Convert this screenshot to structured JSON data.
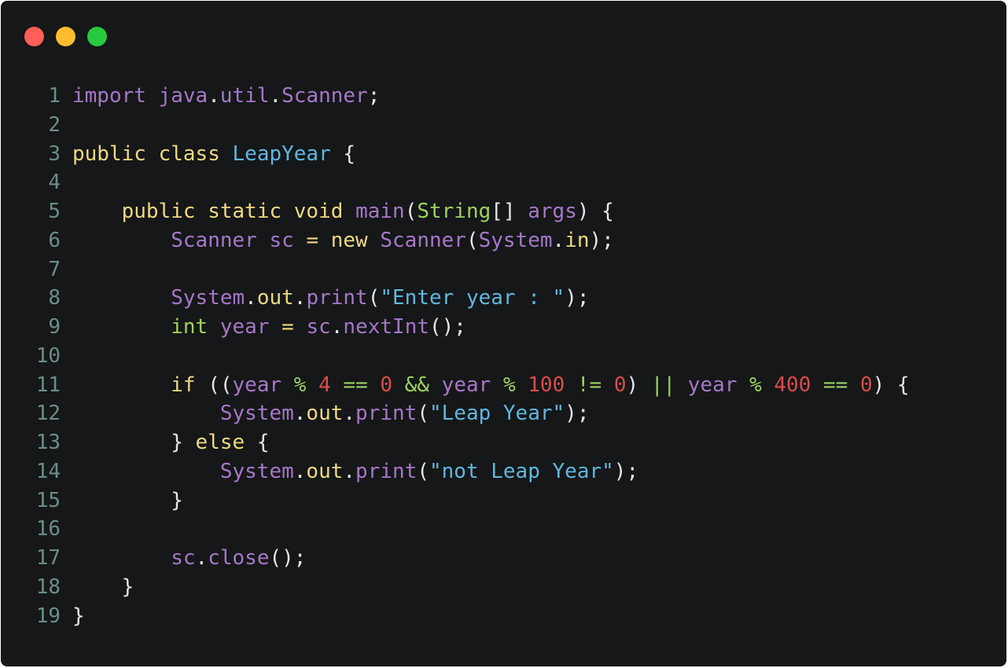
{
  "window": {
    "controls": [
      {
        "name": "close",
        "color": "#ff5f56"
      },
      {
        "name": "minimize",
        "color": "#ffbd2e"
      },
      {
        "name": "zoom",
        "color": "#27c93f"
      }
    ]
  },
  "colors": {
    "keyword": "#f0d880",
    "identifier": "#a677c8",
    "type": "#9ed25e",
    "class_name": "#5fb7e0",
    "string": "#5fb7e0",
    "number": "#dd4b4b",
    "operator": "#9ed25e",
    "punct": "#e6e6e6",
    "line_number": "#6b8d8a"
  },
  "code": {
    "language": "java",
    "lines": [
      {
        "n": "1",
        "tokens": [
          {
            "t": "import",
            "c": "identifier"
          },
          {
            "t": " ",
            "c": "punct"
          },
          {
            "t": "java",
            "c": "identifier"
          },
          {
            "t": ".",
            "c": "punct"
          },
          {
            "t": "util",
            "c": "identifier"
          },
          {
            "t": ".",
            "c": "punct"
          },
          {
            "t": "Scanner",
            "c": "identifier"
          },
          {
            "t": ";",
            "c": "punct"
          }
        ]
      },
      {
        "n": "2",
        "tokens": []
      },
      {
        "n": "3",
        "tokens": [
          {
            "t": "public",
            "c": "keyword"
          },
          {
            "t": " ",
            "c": "punct"
          },
          {
            "t": "class",
            "c": "keyword"
          },
          {
            "t": " ",
            "c": "punct"
          },
          {
            "t": "LeapYear",
            "c": "class_name"
          },
          {
            "t": " {",
            "c": "punct"
          }
        ]
      },
      {
        "n": "4",
        "tokens": []
      },
      {
        "n": "5",
        "tokens": [
          {
            "t": "    ",
            "c": "punct"
          },
          {
            "t": "public",
            "c": "keyword"
          },
          {
            "t": " ",
            "c": "punct"
          },
          {
            "t": "static",
            "c": "keyword"
          },
          {
            "t": " ",
            "c": "punct"
          },
          {
            "t": "void",
            "c": "keyword"
          },
          {
            "t": " ",
            "c": "punct"
          },
          {
            "t": "main",
            "c": "identifier"
          },
          {
            "t": "(",
            "c": "punct"
          },
          {
            "t": "String",
            "c": "type"
          },
          {
            "t": "[] ",
            "c": "punct"
          },
          {
            "t": "args",
            "c": "identifier"
          },
          {
            "t": ") {",
            "c": "punct"
          }
        ]
      },
      {
        "n": "6",
        "tokens": [
          {
            "t": "        ",
            "c": "punct"
          },
          {
            "t": "Scanner",
            "c": "identifier"
          },
          {
            "t": " ",
            "c": "punct"
          },
          {
            "t": "sc",
            "c": "identifier"
          },
          {
            "t": " ",
            "c": "punct"
          },
          {
            "t": "=",
            "c": "keyword"
          },
          {
            "t": " ",
            "c": "punct"
          },
          {
            "t": "new",
            "c": "keyword"
          },
          {
            "t": " ",
            "c": "punct"
          },
          {
            "t": "Scanner",
            "c": "identifier"
          },
          {
            "t": "(",
            "c": "punct"
          },
          {
            "t": "System",
            "c": "identifier"
          },
          {
            "t": ".",
            "c": "punct"
          },
          {
            "t": "in",
            "c": "keyword"
          },
          {
            "t": ");",
            "c": "punct"
          }
        ]
      },
      {
        "n": "7",
        "tokens": []
      },
      {
        "n": "8",
        "tokens": [
          {
            "t": "        ",
            "c": "punct"
          },
          {
            "t": "System",
            "c": "identifier"
          },
          {
            "t": ".",
            "c": "punct"
          },
          {
            "t": "out",
            "c": "keyword"
          },
          {
            "t": ".",
            "c": "punct"
          },
          {
            "t": "print",
            "c": "identifier"
          },
          {
            "t": "(",
            "c": "punct"
          },
          {
            "t": "\"Enter year : \"",
            "c": "string"
          },
          {
            "t": ");",
            "c": "punct"
          }
        ]
      },
      {
        "n": "9",
        "tokens": [
          {
            "t": "        ",
            "c": "punct"
          },
          {
            "t": "int",
            "c": "type"
          },
          {
            "t": " ",
            "c": "punct"
          },
          {
            "t": "year",
            "c": "identifier"
          },
          {
            "t": " ",
            "c": "punct"
          },
          {
            "t": "=",
            "c": "keyword"
          },
          {
            "t": " ",
            "c": "punct"
          },
          {
            "t": "sc",
            "c": "identifier"
          },
          {
            "t": ".",
            "c": "punct"
          },
          {
            "t": "nextInt",
            "c": "identifier"
          },
          {
            "t": "();",
            "c": "punct"
          }
        ]
      },
      {
        "n": "10",
        "tokens": []
      },
      {
        "n": "11",
        "tokens": [
          {
            "t": "        ",
            "c": "punct"
          },
          {
            "t": "if",
            "c": "keyword"
          },
          {
            "t": " ((",
            "c": "punct"
          },
          {
            "t": "year",
            "c": "identifier"
          },
          {
            "t": " ",
            "c": "punct"
          },
          {
            "t": "%",
            "c": "operator"
          },
          {
            "t": " ",
            "c": "punct"
          },
          {
            "t": "4",
            "c": "number"
          },
          {
            "t": " ",
            "c": "punct"
          },
          {
            "t": "==",
            "c": "operator"
          },
          {
            "t": " ",
            "c": "punct"
          },
          {
            "t": "0",
            "c": "number"
          },
          {
            "t": " ",
            "c": "punct"
          },
          {
            "t": "&&",
            "c": "operator"
          },
          {
            "t": " ",
            "c": "punct"
          },
          {
            "t": "year",
            "c": "identifier"
          },
          {
            "t": " ",
            "c": "punct"
          },
          {
            "t": "%",
            "c": "operator"
          },
          {
            "t": " ",
            "c": "punct"
          },
          {
            "t": "100",
            "c": "number"
          },
          {
            "t": " ",
            "c": "punct"
          },
          {
            "t": "!=",
            "c": "operator"
          },
          {
            "t": " ",
            "c": "punct"
          },
          {
            "t": "0",
            "c": "number"
          },
          {
            "t": ") ",
            "c": "punct"
          },
          {
            "t": "||",
            "c": "operator"
          },
          {
            "t": " ",
            "c": "punct"
          },
          {
            "t": "year",
            "c": "identifier"
          },
          {
            "t": " ",
            "c": "punct"
          },
          {
            "t": "%",
            "c": "operator"
          },
          {
            "t": " ",
            "c": "punct"
          },
          {
            "t": "400",
            "c": "number"
          },
          {
            "t": " ",
            "c": "punct"
          },
          {
            "t": "==",
            "c": "operator"
          },
          {
            "t": " ",
            "c": "punct"
          },
          {
            "t": "0",
            "c": "number"
          },
          {
            "t": ") {",
            "c": "punct"
          }
        ]
      },
      {
        "n": "12",
        "tokens": [
          {
            "t": "            ",
            "c": "punct"
          },
          {
            "t": "System",
            "c": "identifier"
          },
          {
            "t": ".",
            "c": "punct"
          },
          {
            "t": "out",
            "c": "keyword"
          },
          {
            "t": ".",
            "c": "punct"
          },
          {
            "t": "print",
            "c": "identifier"
          },
          {
            "t": "(",
            "c": "punct"
          },
          {
            "t": "\"Leap Year\"",
            "c": "string"
          },
          {
            "t": ");",
            "c": "punct"
          }
        ]
      },
      {
        "n": "13",
        "tokens": [
          {
            "t": "        } ",
            "c": "punct"
          },
          {
            "t": "else",
            "c": "keyword"
          },
          {
            "t": " {",
            "c": "punct"
          }
        ]
      },
      {
        "n": "14",
        "tokens": [
          {
            "t": "            ",
            "c": "punct"
          },
          {
            "t": "System",
            "c": "identifier"
          },
          {
            "t": ".",
            "c": "punct"
          },
          {
            "t": "out",
            "c": "keyword"
          },
          {
            "t": ".",
            "c": "punct"
          },
          {
            "t": "print",
            "c": "identifier"
          },
          {
            "t": "(",
            "c": "punct"
          },
          {
            "t": "\"not Leap Year\"",
            "c": "string"
          },
          {
            "t": ");",
            "c": "punct"
          }
        ]
      },
      {
        "n": "15",
        "tokens": [
          {
            "t": "        }",
            "c": "punct"
          }
        ]
      },
      {
        "n": "16",
        "tokens": []
      },
      {
        "n": "17",
        "tokens": [
          {
            "t": "        ",
            "c": "punct"
          },
          {
            "t": "sc",
            "c": "identifier"
          },
          {
            "t": ".",
            "c": "punct"
          },
          {
            "t": "close",
            "c": "identifier"
          },
          {
            "t": "();",
            "c": "punct"
          }
        ]
      },
      {
        "n": "18",
        "tokens": [
          {
            "t": "    }",
            "c": "punct"
          }
        ]
      },
      {
        "n": "19",
        "tokens": [
          {
            "t": "}",
            "c": "punct"
          }
        ]
      }
    ]
  }
}
